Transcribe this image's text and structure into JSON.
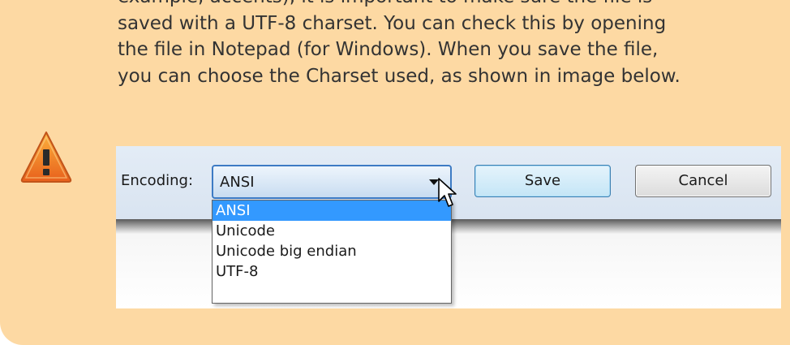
{
  "note": {
    "lines": [
      "example, accents), it is important to make sure the file is",
      "saved with a UTF-8 charset. You can check this by opening",
      "the file in Notepad (for Windows). When you save the file,",
      "you can choose the Charset used, as shown in image below."
    ],
    "icon": "warning-triangle-icon",
    "background_color": "#fdd9a3",
    "text_color": "#333333"
  },
  "dialog": {
    "encoding_label": "Encoding:",
    "encoding_selected": "ANSI",
    "save_label": "Save",
    "cancel_label": "Cancel",
    "options": [
      {
        "label": "ANSI",
        "selected": true
      },
      {
        "label": "Unicode",
        "selected": false
      },
      {
        "label": "Unicode big endian",
        "selected": false
      },
      {
        "label": "UTF-8",
        "selected": false
      }
    ],
    "highlight_color": "#3399ff"
  }
}
